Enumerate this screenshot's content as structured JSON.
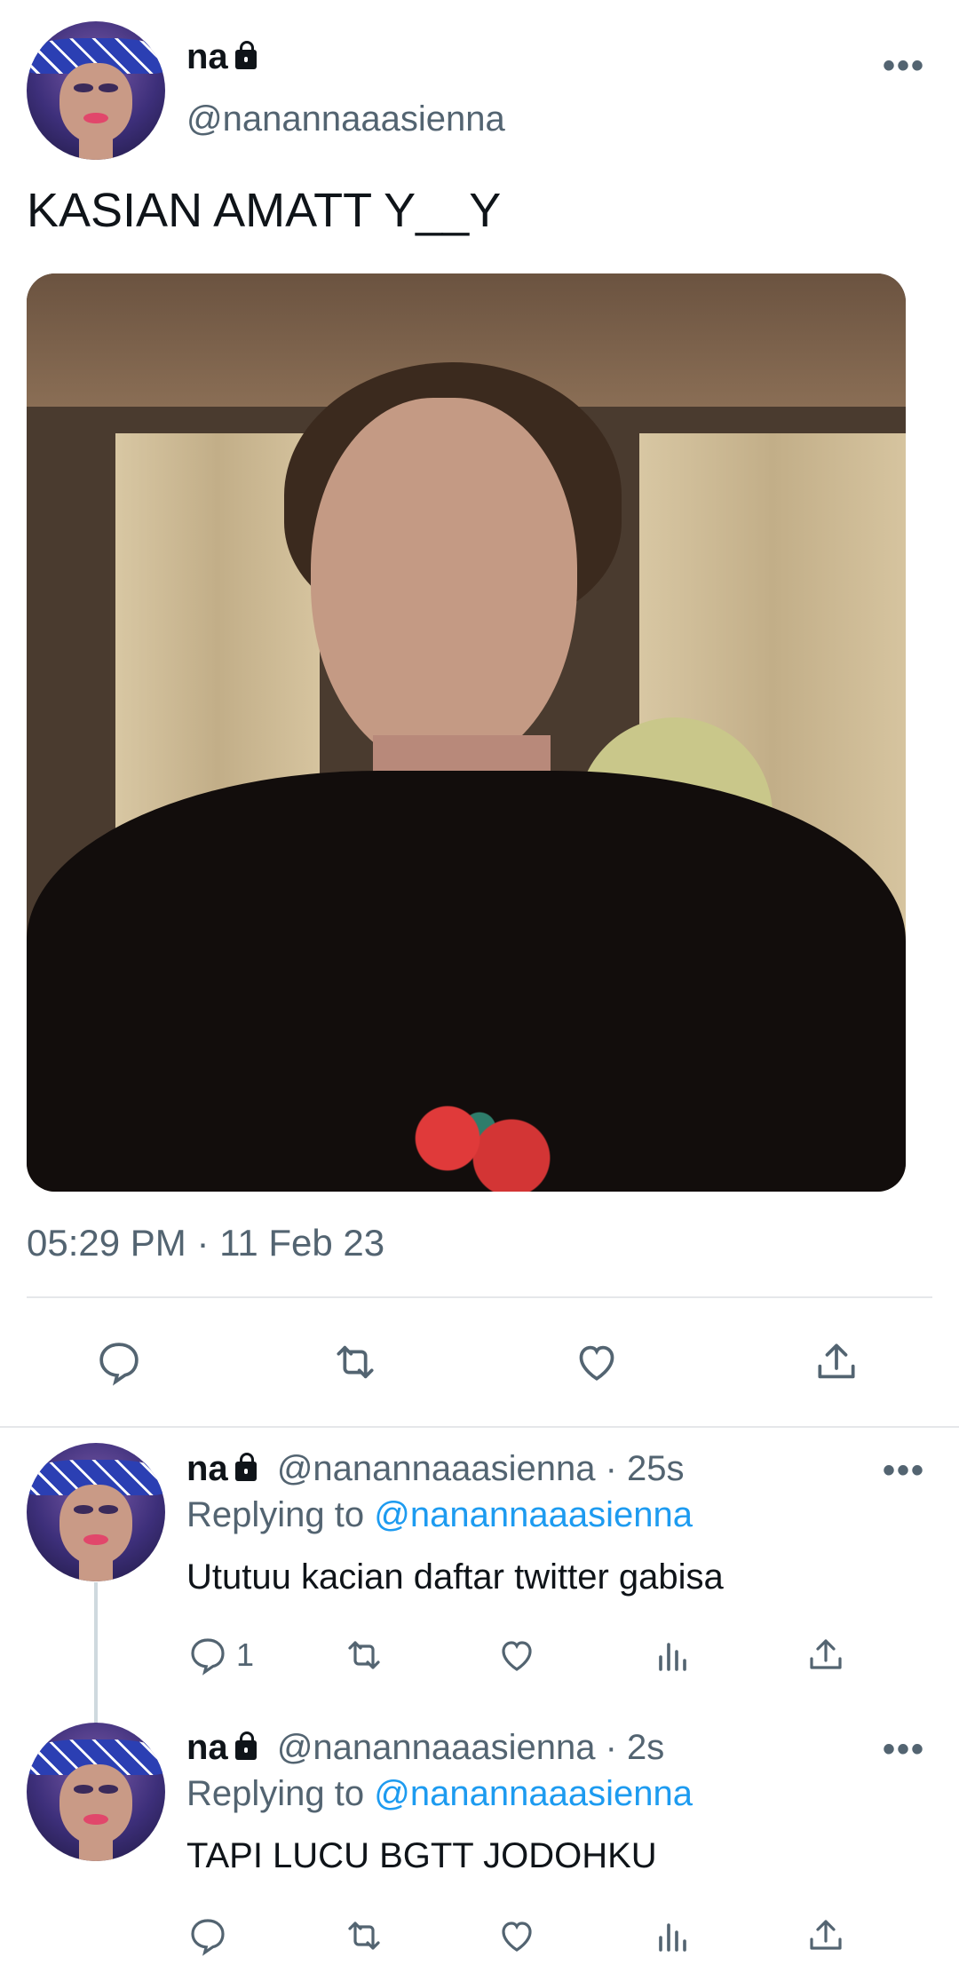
{
  "main_tweet": {
    "display_name": "na",
    "handle": "@nanannaaasienna",
    "text": "KASIAN AMATT Y__Y",
    "timestamp": "05:29 PM · 11 Feb 23",
    "more_label": "•••"
  },
  "replies": [
    {
      "display_name": "na",
      "handle_time": "@nanannaaasienna · 25s",
      "replying_prefix": "Replying to",
      "replying_to": "@nanannaaasienna",
      "text": "Ututuu kacian daftar twitter gabisa",
      "reply_count": "1",
      "more_label": "•••"
    },
    {
      "display_name": "na",
      "handle_time": "@nanannaaasienna · 2s",
      "replying_prefix": "Replying to",
      "replying_to": "@nanannaaasienna",
      "text": "TAPI LUCU BGTT JODOHKU",
      "reply_count": "",
      "more_label": "•••"
    }
  ],
  "colors": {
    "text_primary": "#0f1419",
    "text_secondary": "#536471",
    "link": "#1d9bf0",
    "divider": "#e5e7ea"
  },
  "icons": [
    "lock-icon",
    "more-icon",
    "reply-icon",
    "retweet-icon",
    "like-icon",
    "share-icon",
    "views-icon"
  ]
}
